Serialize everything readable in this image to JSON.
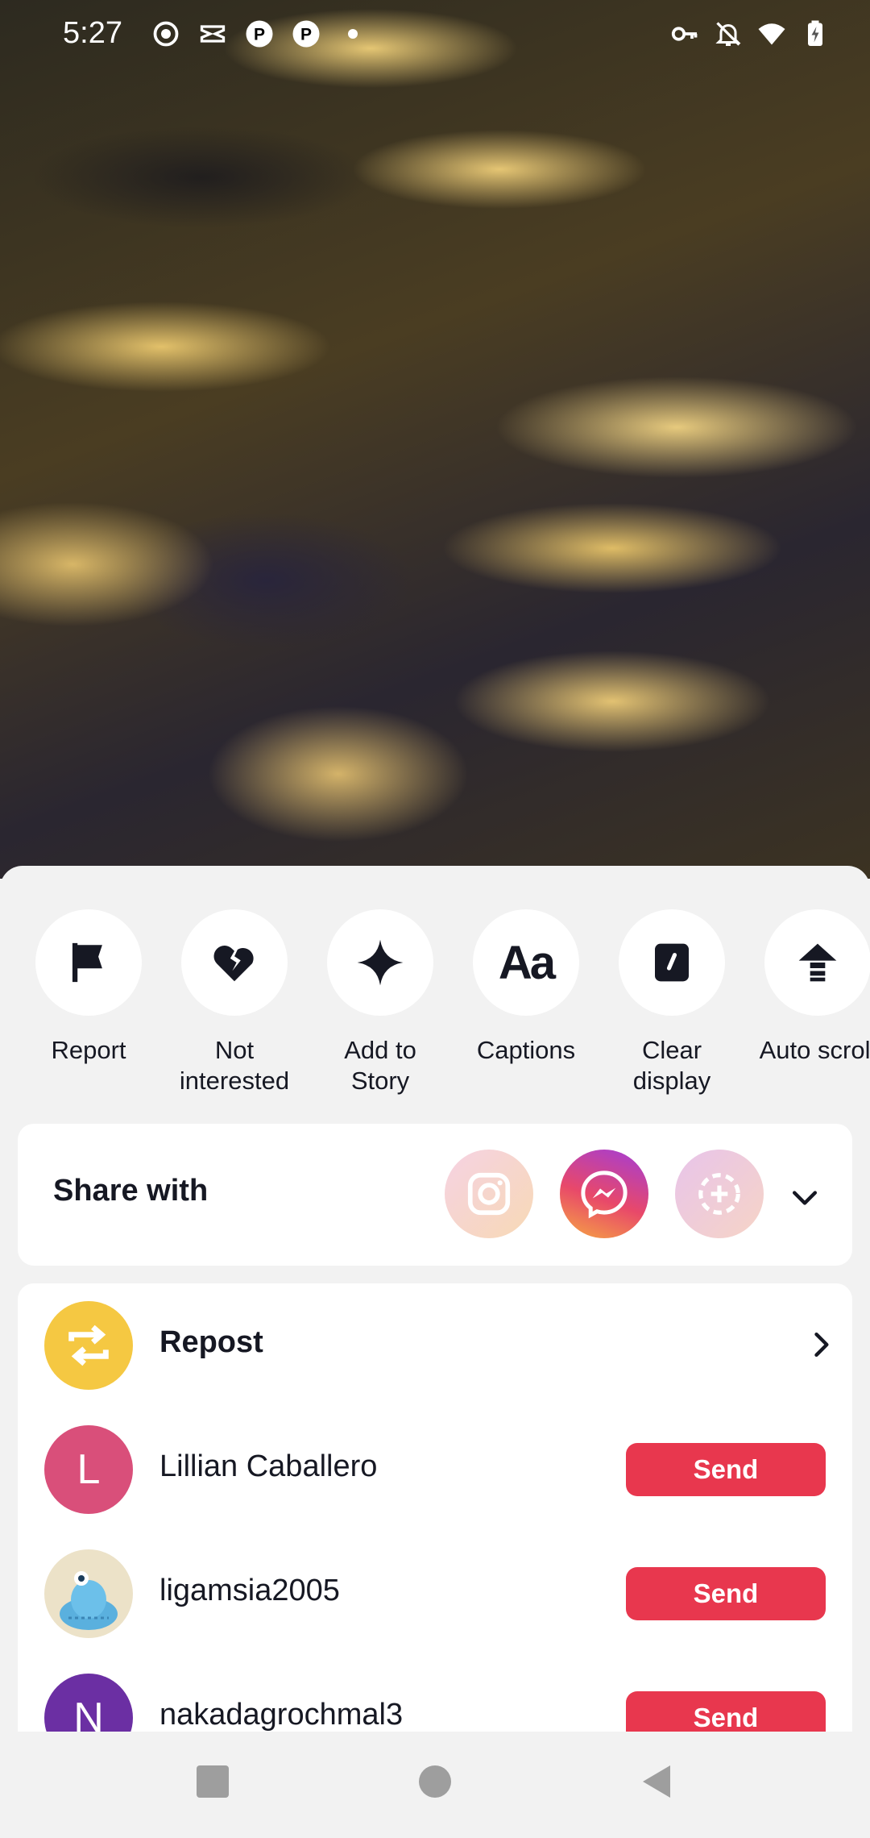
{
  "status_bar": {
    "time": "5:27",
    "left_icons": [
      "record-icon",
      "capcut-icon",
      "pinterest-icon",
      "pinterest-icon",
      "dot-icon"
    ],
    "right_icons": [
      "key-icon",
      "notifications-off-icon",
      "wifi-icon",
      "battery-charging-icon"
    ]
  },
  "actions": [
    {
      "label": "Report",
      "icon": "flag-icon"
    },
    {
      "label": "Not\ninterested",
      "icon": "broken-heart-icon"
    },
    {
      "label": "Add to\nStory",
      "icon": "sparkle-icon"
    },
    {
      "label": "Captions",
      "icon": "captions-icon"
    },
    {
      "label": "Clear\ndisplay",
      "icon": "clear-display-icon"
    },
    {
      "label": "Auto scroll",
      "icon": "auto-scroll-icon"
    }
  ],
  "share": {
    "title": "Share with",
    "apps": [
      "instagram-icon",
      "messenger-icon",
      "add-contact-icon"
    ],
    "expand_icon": "chevron-down-icon"
  },
  "list": {
    "repost": {
      "label": "Repost",
      "icon": "repost-icon",
      "color": "#f5c842"
    },
    "contacts": [
      {
        "name": "Lillian Caballero",
        "initial": "L",
        "color": "#d94f7a",
        "action": "Send"
      },
      {
        "name": "ligamsia2005",
        "initial": "",
        "color": "#e9dcc0",
        "action": "Send"
      },
      {
        "name": "nakadagrochmal3",
        "initial": "N",
        "color": "#6b2fa3",
        "action": "Send"
      }
    ]
  },
  "colors": {
    "accent": "#e8374e",
    "sheet_bg": "#f2f2f2"
  }
}
